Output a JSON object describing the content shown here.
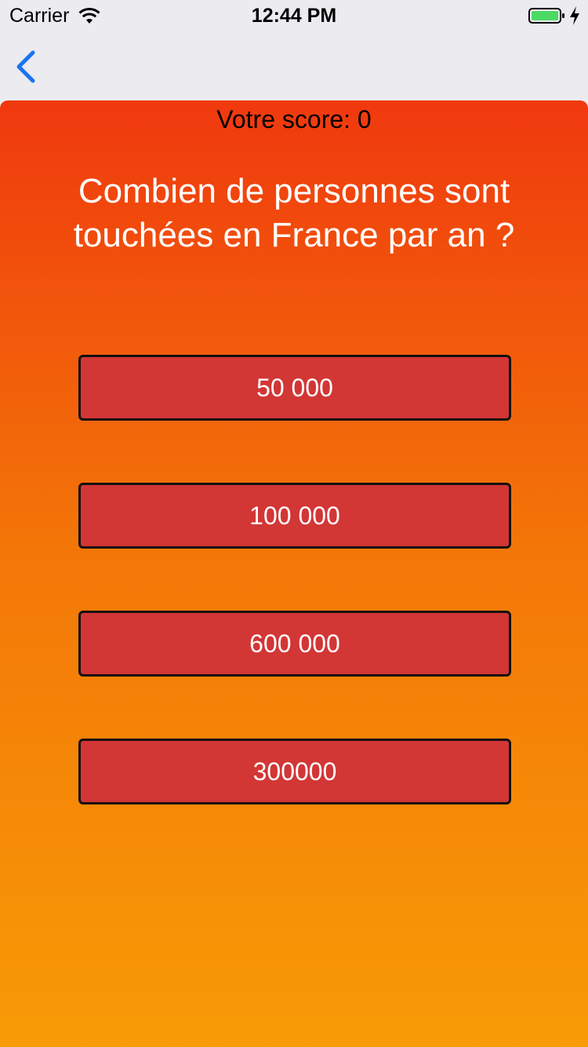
{
  "status_bar": {
    "carrier": "Carrier",
    "time": "12:44 PM",
    "wifi_icon": "wifi-icon",
    "battery_icon": "battery-charging-icon",
    "battery_color": "#4cd964"
  },
  "nav_bar": {
    "back_icon": "chevron-left-icon",
    "back_color": "#1a73f0"
  },
  "quiz": {
    "score_label": "Votre score: 0",
    "question": "Combien de personnes sont touchées en France par an ?",
    "answers": [
      {
        "label": "50 000"
      },
      {
        "label": "100 000"
      },
      {
        "label": "600 000"
      },
      {
        "label": "300000"
      }
    ],
    "colors": {
      "gradient_top": "#f0390e",
      "gradient_bottom": "#f89b06",
      "button_fill": "#d23635"
    }
  }
}
